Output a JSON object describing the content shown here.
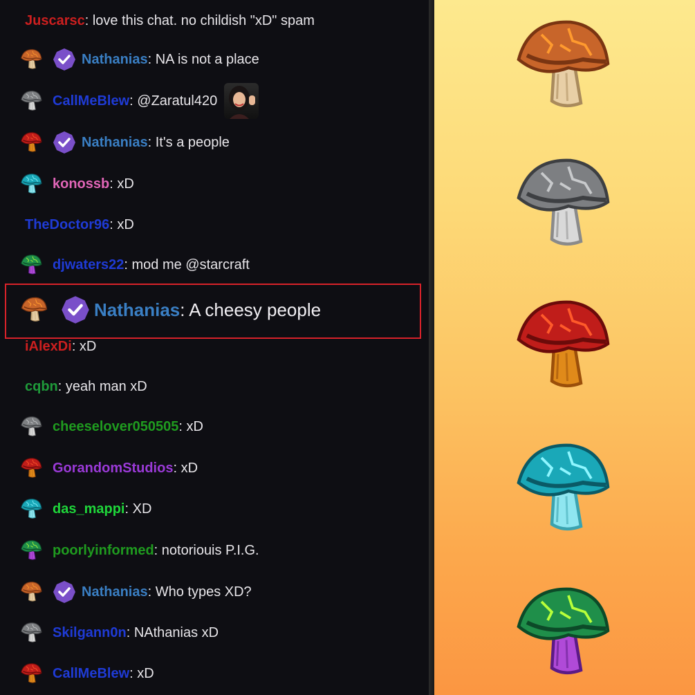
{
  "chat": {
    "messages": [
      {
        "badge": "none",
        "verified": false,
        "user": "Juscarsc",
        "user_color": "#cc1f1f",
        "text": ": love this chat. no childish \"xD\" spam"
      },
      {
        "badge": "orange",
        "verified": true,
        "user": "Nathanias",
        "user_color": "#3a7fc4",
        "text": ": NA is not a place"
      },
      {
        "badge": "gray",
        "verified": false,
        "user": "CallMeBlew",
        "user_color": "#1f3bd6",
        "text": ": @Zaratul420",
        "emote": "waving-woman"
      },
      {
        "badge": "red",
        "verified": true,
        "user": "Nathanias",
        "user_color": "#3a7fc4",
        "text": ": It's a people"
      },
      {
        "badge": "teal",
        "verified": false,
        "user": "konossb",
        "user_color": "#e266b8",
        "text": ": xD"
      },
      {
        "badge": "none",
        "verified": false,
        "user": "TheDoctor96",
        "user_color": "#1f3bd6",
        "text": ": xD"
      },
      {
        "badge": "green-purple",
        "verified": false,
        "user": "djwaters22",
        "user_color": "#1f3bd6",
        "text": ": mod me @starcraft"
      },
      {
        "badge": "none",
        "verified": false,
        "user": "iAlexDi",
        "user_color": "#cc1f1f",
        "text": ": xD"
      },
      {
        "badge": "none",
        "verified": false,
        "user": "cqbn",
        "user_color": "#1f9b3a",
        "text": ": yeah man xD"
      },
      {
        "badge": "gray",
        "verified": false,
        "user": "cheeselover050505",
        "user_color": "#1f9b1f",
        "text": ": xD"
      },
      {
        "badge": "red",
        "verified": false,
        "user": "GorandomStudios",
        "user_color": "#9b3ad8",
        "text": ": xD"
      },
      {
        "badge": "teal",
        "verified": false,
        "user": "das_mappi",
        "user_color": "#1fd63a",
        "text": ": XD"
      },
      {
        "badge": "green-purple",
        "verified": false,
        "user": "poorlyinformed",
        "user_color": "#1f9b1f",
        "text": ": notoriouis P.I.G."
      },
      {
        "badge": "orange",
        "verified": true,
        "user": "Nathanias",
        "user_color": "#3a7fc4",
        "text": ": Who types XD?"
      },
      {
        "badge": "gray",
        "verified": false,
        "user": "Skilgann0n",
        "user_color": "#1f3bd6",
        "text": ": NAthanias xD"
      },
      {
        "badge": "red",
        "verified": false,
        "user": "CallMeBlew",
        "user_color": "#1f3bd6",
        "text": ": xD"
      }
    ],
    "highlighted": {
      "badge": "orange",
      "verified": true,
      "user": "Nathanias",
      "user_color": "#3a7fc4",
      "text": ": A cheesy people"
    }
  },
  "showcase": {
    "badges": [
      "orange-mushroom-badge",
      "gray-mushroom-badge",
      "red-mushroom-badge",
      "teal-mushroom-badge",
      "green-purple-mushroom-badge"
    ]
  },
  "colors": {
    "chat_bg": "#0e0e13",
    "highlight_border": "#d8222a",
    "verified_purple": "#7a4fc9",
    "gradient_top": "#fde98e",
    "gradient_bottom": "#fb9642"
  }
}
